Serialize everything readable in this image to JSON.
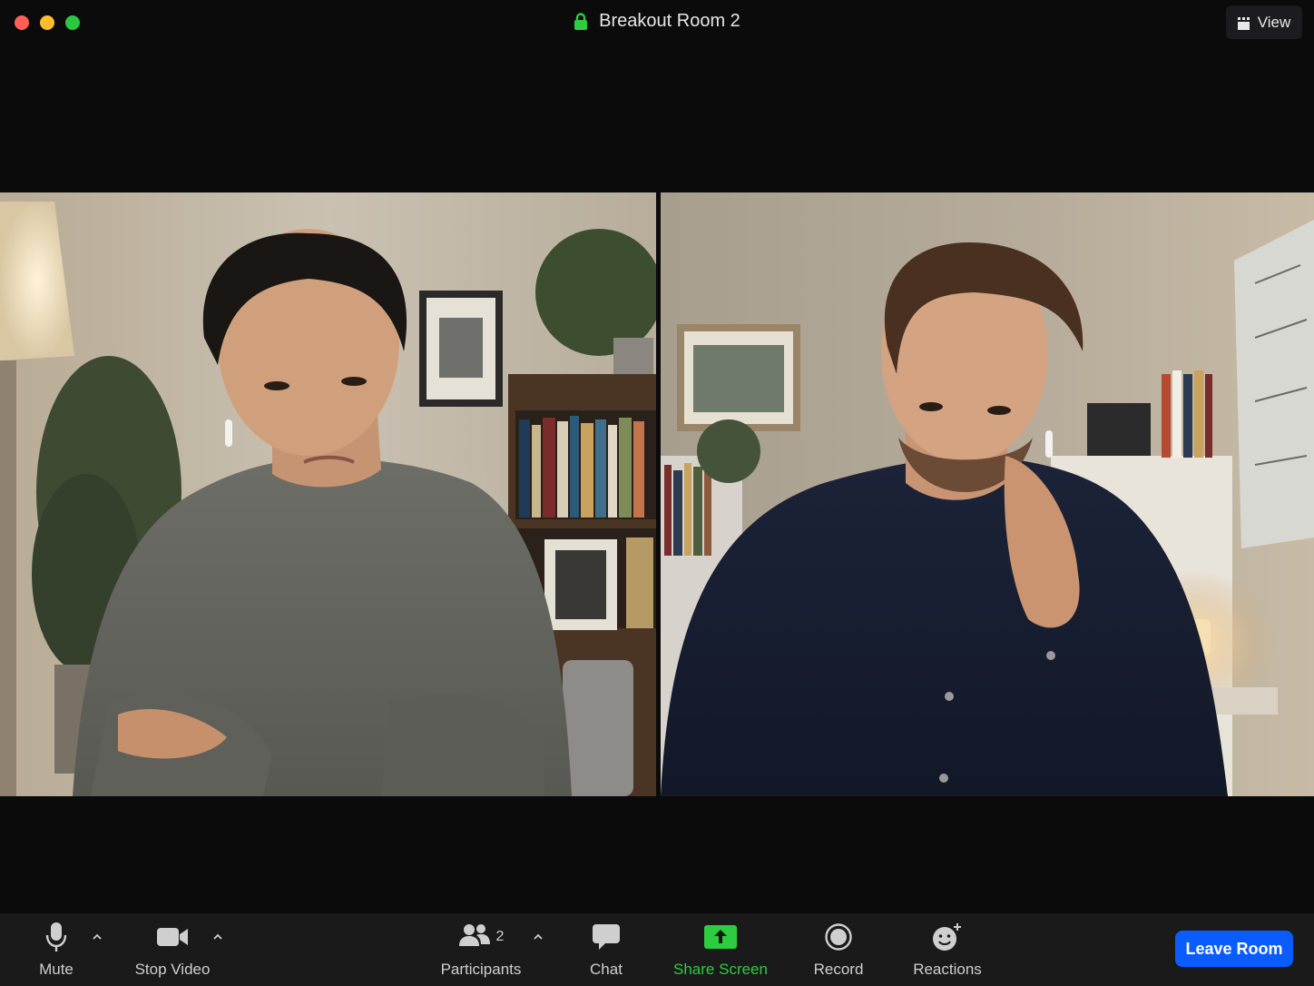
{
  "window": {
    "title": "Breakout Room 2",
    "view_label": "View"
  },
  "participants": [
    {
      "tile": "left",
      "description_icon": "person-video-feed"
    },
    {
      "tile": "right",
      "description_icon": "person-video-feed"
    }
  ],
  "toolbar": {
    "mute_label": "Mute",
    "stop_video_label": "Stop Video",
    "participants_label": "Participants",
    "participants_count": "2",
    "chat_label": "Chat",
    "share_screen_label": "Share Screen",
    "record_label": "Record",
    "reactions_label": "Reactions",
    "leave_label": "Leave Room"
  },
  "colors": {
    "share_screen_accent": "#2ecc40",
    "leave_button": "#0b5cff",
    "lock_icon": "#2ecc40"
  }
}
